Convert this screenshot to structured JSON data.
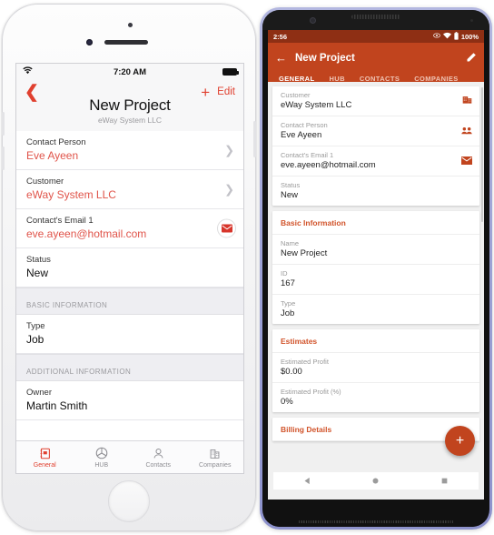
{
  "ios": {
    "status": {
      "wifi_icon": "wifi-icon",
      "time": "7:20 AM",
      "battery_icon": "battery-full-icon"
    },
    "nav": {
      "back_icon": "chevron-left-icon",
      "add_icon": "plus-icon",
      "edit_label": "Edit",
      "title": "New Project",
      "subtitle": "eWay System LLC"
    },
    "rows": [
      {
        "label": "Contact Person",
        "value": "Eve Ayeen",
        "accent": true,
        "accessory": "chevron-right-icon"
      },
      {
        "label": "Customer",
        "value": "eWay System LLC",
        "accent": true,
        "accessory": "chevron-right-icon"
      },
      {
        "label": "Contact's Email 1",
        "value": "eve.ayeen@hotmail.com",
        "accent": true,
        "accessory": "mail-icon"
      },
      {
        "label": "Status",
        "value": "New",
        "accent": false,
        "accessory": "none"
      }
    ],
    "section_basic": "BASIC INFORMATION",
    "basic_rows": [
      {
        "label": "Type",
        "value": "Job"
      }
    ],
    "section_additional": "ADDITIONAL INFORMATION",
    "additional_rows": [
      {
        "label": "Owner",
        "value": "Martin Smith"
      }
    ],
    "tabs": [
      {
        "label": "General",
        "icon": "notebook-icon",
        "active": true
      },
      {
        "label": "HUB",
        "icon": "hub-wheel-icon",
        "active": false
      },
      {
        "label": "Contacts",
        "icon": "person-icon",
        "active": false
      },
      {
        "label": "Companies",
        "icon": "building-icon",
        "active": false
      }
    ]
  },
  "android": {
    "status": {
      "time": "2:56",
      "icons": [
        "eye-icon",
        "wifi-icon",
        "battery-icon"
      ],
      "battery_label": "100%"
    },
    "appbar": {
      "back_icon": "arrow-left-icon",
      "title": "New Project",
      "edit_icon": "pencil-icon"
    },
    "tabs": [
      {
        "label": "GENERAL",
        "active": true
      },
      {
        "label": "HUB",
        "active": false
      },
      {
        "label": "CONTACTS",
        "active": false
      },
      {
        "label": "COMPANIES",
        "active": false
      }
    ],
    "cards": [
      {
        "title": null,
        "rows": [
          {
            "label": "Customer",
            "value": "eWay System LLC",
            "icon": "building-icon"
          },
          {
            "label": "Contact Person",
            "value": "Eve Ayeen",
            "icon": "people-icon"
          },
          {
            "label": "Contact's Email 1",
            "value": "eve.ayeen@hotmail.com",
            "icon": "mail-icon"
          },
          {
            "label": "Status",
            "value": "New",
            "icon": "none"
          }
        ]
      },
      {
        "title": "Basic Information",
        "rows": [
          {
            "label": "Name",
            "value": "New Project",
            "icon": "none"
          },
          {
            "label": "ID",
            "value": "167",
            "icon": "none"
          },
          {
            "label": "Type",
            "value": "Job",
            "icon": "none"
          }
        ]
      },
      {
        "title": "Estimates",
        "rows": [
          {
            "label": "Estimated Profit",
            "value": "$0.00",
            "icon": "none"
          },
          {
            "label": "Estimated Profit (%)",
            "value": "0%",
            "icon": "none"
          }
        ]
      },
      {
        "title": "Billing Details",
        "rows": []
      }
    ],
    "fab": {
      "icon": "plus-icon"
    },
    "navbar": [
      "back-triangle-icon",
      "home-circle-icon",
      "recents-square-icon"
    ]
  },
  "colors": {
    "ios_accent": "#e0402f",
    "ios_value_accent": "#e0544a",
    "android_appbar": "#c1441e",
    "android_statusbar": "#8e2f14",
    "android_card_title": "#d1532a"
  }
}
